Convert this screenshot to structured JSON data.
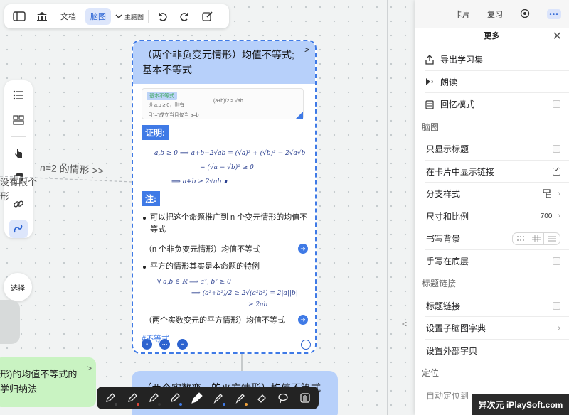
{
  "toolbar": {
    "tab_doc": "文档",
    "tab_mindmap": "脑图",
    "mindmap_select": "主脑图"
  },
  "left_tools": {
    "select_label": "选择"
  },
  "canvas": {
    "edge_label": "n=2 的情形 >>",
    "edge_partial": "没有限个\n形",
    "green_node_text": "形)的均值不等式的\n学归纳法",
    "card2_title": "（两个实数变元的平方情形）均值不等式"
  },
  "card": {
    "title": "（两个非负变元情形）均值不等式;\n基本不等式",
    "thumb": {
      "tag": "基本不等式",
      "line1": "设 a,b ≥ 0，则有",
      "formula": "(a+b)/2 ≥ √ab",
      "line2": "且“=”成立当且仅当 a=b"
    },
    "proof_tag": "证明:",
    "proof_lines": [
      "a,b ≥ 0 ⟹ a+b−2√ab = (√a)² + (√b)² − 2√a√b",
      "= (√a − √b)² ≥ 0",
      "⟹ a+b ≥ 2√ab  ∎"
    ],
    "note_tag": "注:",
    "bullet1": "可以把这个命题推广到 n 个变元情形的均值不等式",
    "link1": "（n 个非负变元情形）均值不等式",
    "bullet2": "平方的情形其实是本命题的特例",
    "hw_lines": [
      "∀ a,b ∈ ℝ ⟹ a², b² ≥ 0",
      "⟹ (a²+b²)/2 ≥ 2√(a²b²) = 2|a||b|",
      "≥ 2ab"
    ],
    "link2": "（两个实数变元的平方情形）均值不等式",
    "hashtag": "#不等式",
    "arrow": ">"
  },
  "panel": {
    "tabs": [
      "卡片",
      "复习"
    ],
    "title": "更多",
    "rows": [
      {
        "label": "导出学习集",
        "kind": "icon-row",
        "icon": "export-icon"
      },
      {
        "label": "朗读",
        "kind": "icon-row",
        "icon": "speaker-icon"
      },
      {
        "label": "回忆模式",
        "kind": "icon-row",
        "icon": "clipboard-icon",
        "checked": false
      },
      {
        "label": "脑图",
        "kind": "group"
      },
      {
        "label": "只显示标题",
        "kind": "check",
        "checked": false
      },
      {
        "label": "在卡片中显示链接",
        "kind": "check",
        "checked": true
      },
      {
        "label": "分支样式",
        "kind": "nav",
        "icon": "branch-style-icon"
      },
      {
        "label": "尺寸和比例",
        "kind": "nav",
        "value": "700"
      },
      {
        "label": "书写背景",
        "kind": "segment"
      },
      {
        "label": "手写在底层",
        "kind": "check",
        "checked": false
      },
      {
        "label": "标题链接",
        "kind": "group"
      },
      {
        "label": "标题链接",
        "kind": "check",
        "checked": false
      },
      {
        "label": "设置子脑图字典",
        "kind": "nav"
      },
      {
        "label": "设置外部字典",
        "kind": "plain"
      },
      {
        "label": "定位",
        "kind": "group"
      },
      {
        "label": "自动定位到",
        "kind": "plain"
      }
    ]
  },
  "watermark": "异次元 iPlaySoft.com",
  "colors": {
    "accent": "#3f7ae6",
    "card_header": "#b7d0fa",
    "green_node": "#c9f3c2",
    "drawbar": "#232323"
  }
}
